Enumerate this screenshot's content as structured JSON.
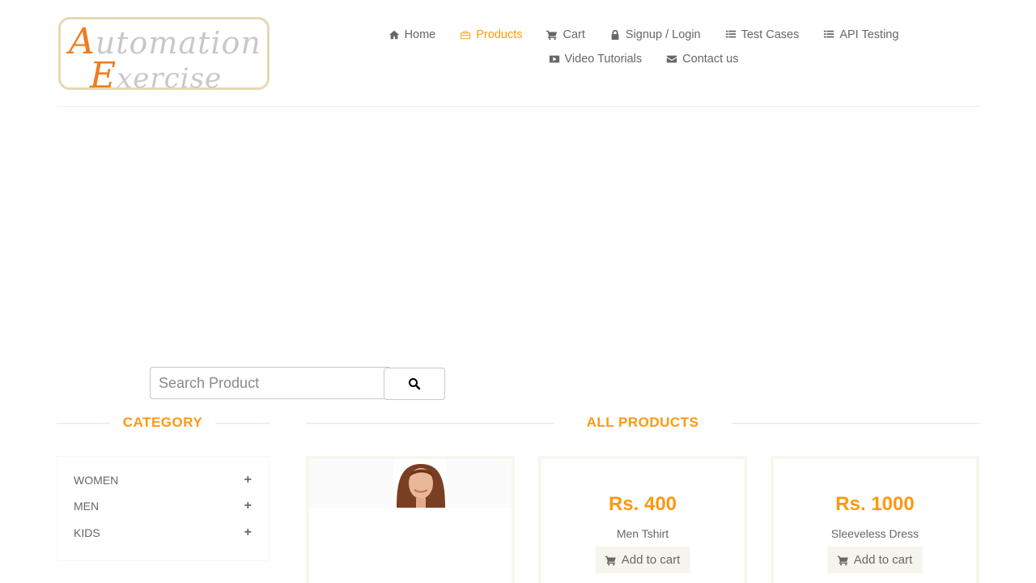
{
  "logo": {
    "line1_cap": "A",
    "line1_rest": "utomation",
    "line2_cap": "E",
    "line2_rest": "xercise"
  },
  "nav": {
    "row1": [
      {
        "label": "Home",
        "icon": "home-icon"
      },
      {
        "label": "Products",
        "icon": "briefcase-icon",
        "active": true
      },
      {
        "label": "Cart",
        "icon": "cart-icon"
      },
      {
        "label": "Signup / Login",
        "icon": "lock-icon"
      },
      {
        "label": "Test Cases",
        "icon": "list-icon"
      },
      {
        "label": "API Testing",
        "icon": "list-icon"
      }
    ],
    "row2": [
      {
        "label": "Video Tutorials",
        "icon": "youtube-play-icon"
      },
      {
        "label": "Contact us",
        "icon": "envelope-icon"
      }
    ]
  },
  "search": {
    "placeholder": "Search Product",
    "icon": "search-icon"
  },
  "category": {
    "title": "CATEGORY",
    "items": [
      {
        "label": "WOMEN",
        "expand": "+"
      },
      {
        "label": "MEN",
        "expand": "+"
      },
      {
        "label": "KIDS",
        "expand": "+"
      }
    ]
  },
  "products": {
    "title": "ALL PRODUCTS",
    "items": [
      {
        "price": "",
        "name": "",
        "cta": "",
        "image": "woman-portrait"
      },
      {
        "price": "Rs. 400",
        "name": "Men Tshirt",
        "cta": "Add to cart"
      },
      {
        "price": "Rs. 1000",
        "name": "Sleeveless Dress",
        "cta": "Add to cart"
      }
    ]
  },
  "colors": {
    "accent": "#fe980f",
    "text": "#696763",
    "button_bg": "#f5f5ed",
    "logo_orange": "#f07c1e"
  }
}
